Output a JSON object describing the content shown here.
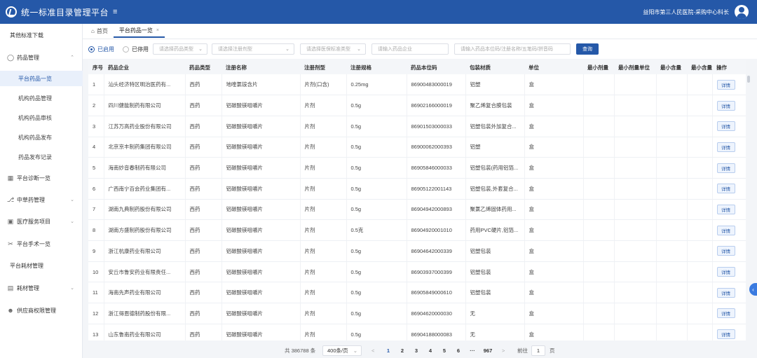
{
  "header": {
    "title": "统一标准目录管理平台",
    "menu_icon": "≡",
    "user": "益阳市第三人民医院-采购中心科长"
  },
  "sidebar": {
    "top_link": "其他标准下载",
    "drug_group": "药品管理",
    "drug_sub": [
      "平台药品一览",
      "机构药品管理",
      "机构药品审核",
      "机构药品发布",
      "药品发布记录"
    ],
    "items": [
      "平台诊断一览",
      "中草药管理",
      "医疗服务项目",
      "平台手术一览",
      "平台耗材管理",
      "耗材管理",
      "供应商权限管理"
    ]
  },
  "tabs": [
    {
      "label": "首页"
    },
    {
      "label": "平台药品一览",
      "close": "×"
    }
  ],
  "filters": {
    "radio_enabled": "已启用",
    "radio_disabled": "已停用",
    "drug_type_placeholder": "请选择药品类型",
    "reg_dosage_placeholder": "请选择注册剂型",
    "medical_insurance_placeholder": "请选择医保标准类型",
    "enterprise_placeholder": "请输入药品企业",
    "code_placeholder": "请输入药品本位码/注册名称/五笔码/拼音码",
    "search_label": "查询"
  },
  "table": {
    "columns": [
      "序号",
      "药品企业",
      "药品类型",
      "注册名称",
      "注册剂型",
      "注册规格",
      "药品本位码",
      "包装材质",
      "单位",
      "最小剂量",
      "最小剂量单位",
      "最小含量",
      "最小含量",
      "操作"
    ],
    "action_label": "详情",
    "rows": [
      [
        "1",
        "汕头经济特区明治医药有...",
        "西药",
        "地喹氯铵含片",
        "片剂(口含)",
        "0.25mg",
        "86900483000019",
        "铝塑",
        "盒"
      ],
      [
        "2",
        "四川健能制药有限公司",
        "西药",
        "铝碳酸镁咀嚼片",
        "片剂",
        "0.5g",
        "86902166000019",
        "聚乙烯复合膜包装",
        "盒"
      ],
      [
        "3",
        "江苏万高药业股份有限公司",
        "西药",
        "铝碳酸镁咀嚼片",
        "片剂",
        "0.5g",
        "86901503000033",
        "铝塑包装外加复合...",
        "盒"
      ],
      [
        "4",
        "北京京丰制药集团有限公司",
        "西药",
        "铝碳酸镁咀嚼片",
        "片剂",
        "0.5g",
        "86900062000393",
        "铝塑",
        "盒"
      ],
      [
        "5",
        "海南妙音春制药有限公司",
        "西药",
        "铝碳酸镁咀嚼片",
        "片剂",
        "0.5g",
        "86905846000033",
        "铝塑包装(药用铝箔...",
        "盒"
      ],
      [
        "6",
        "广西南宁百会药业集团有...",
        "西药",
        "铝碳酸镁咀嚼片",
        "片剂",
        "0.5g",
        "86905122001143",
        "铝塑包装,外套复合...",
        "盒"
      ],
      [
        "7",
        "湖南九典制药股份有限公司",
        "西药",
        "铝碳酸镁咀嚼片",
        "片剂",
        "0.5g",
        "86904942000893",
        "聚氯乙烯固体药用...",
        "盒"
      ],
      [
        "8",
        "湖南方盛制药股份有限公司",
        "西药",
        "铝碳酸镁咀嚼片",
        "片剂",
        "0.5克",
        "86904920001010",
        "药用PVC硬片,铝箔...",
        "盒"
      ],
      [
        "9",
        "浙江杭康药业有限公司",
        "西药",
        "铝碳酸镁咀嚼片",
        "片剂",
        "0.5g",
        "86904642000339",
        "铝塑包装",
        "盒"
      ],
      [
        "10",
        "安丘市鲁安药业有限责任...",
        "西药",
        "铝碳酸镁咀嚼片",
        "片剂",
        "0.5g",
        "86903937000399",
        "铝塑包装",
        "盒"
      ],
      [
        "11",
        "海南先声药业有限公司",
        "西药",
        "铝碳酸镁咀嚼片",
        "片剂",
        "0.5g",
        "86905849000610",
        "铝塑包装",
        "盒"
      ],
      [
        "12",
        "浙江得恩德制药股份有限...",
        "西药",
        "铝碳酸镁咀嚼片",
        "片剂",
        "0.5g",
        "86904620000030",
        "无",
        "盒"
      ],
      [
        "13",
        "山东鲁南药业有限公司",
        "西药",
        "铝碳酸镁咀嚼片",
        "片剂",
        "0.5g",
        "86904188000083",
        "无",
        "盒"
      ]
    ]
  },
  "pagination": {
    "total": "共 386788 条",
    "page_size": "400条/页",
    "prev": "<",
    "next": ">",
    "pages": [
      "1",
      "2",
      "3",
      "4",
      "5",
      "6",
      "···",
      "967"
    ],
    "goto_label": "前往",
    "goto_value": "1",
    "page_suffix": "页"
  },
  "colors": {
    "primary": "#2558a8",
    "accent": "#3a7be0"
  }
}
